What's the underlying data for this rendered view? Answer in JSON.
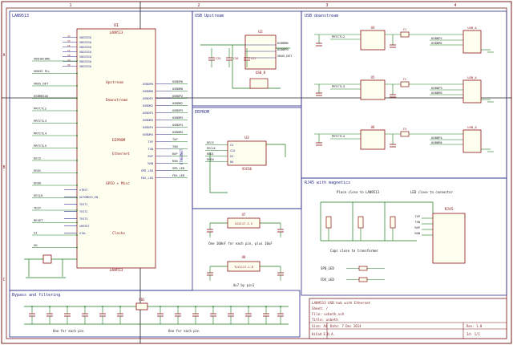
{
  "sheet": {
    "frame_color": "#7a1e1e",
    "section_color": "#2d2d8c",
    "wire_color": "#1a7a1a",
    "part_color": "#8a1010",
    "label_color": "#1a1a1a",
    "pin_color": "#2d2d8c",
    "top_ruler": [
      "1",
      "2",
      "3",
      "4"
    ],
    "side_ruler": [
      "A",
      "B",
      "C"
    ]
  },
  "sections": {
    "main": "LAN9513",
    "usb_upstream": "USB Upstream",
    "usb_downstream": "USB downstream",
    "eeprom": "EEPROM",
    "rj45": "RJ45 with magnetics",
    "bypass": "Bypass and filtering"
  },
  "main": {
    "ic_ref": "U1",
    "ic_value": "LAN9513",
    "ic_footer": "LAN9513",
    "left_pins": [
      "VDD33IO",
      "VDD33IO",
      "VDD33IO",
      "VDD33IO",
      "VDD33IO",
      "VDD33IO",
      "VDD33IO"
    ],
    "nets_left": [
      "VDD18CORE",
      "VDD33 PLL",
      "VBUS_DET",
      "USBRBIAS",
      "PRTCTL2",
      "PRTCTL3",
      "PRTCTL4",
      "PRTCTL5",
      "EECS",
      "EEDI",
      "EEDO",
      "EECLK",
      "TEST",
      "RESET",
      "XI",
      "XO"
    ],
    "right_pins": [
      "USBDP0",
      "USBDM0",
      "USBDP2",
      "USBDM2",
      "USBDP3",
      "USBDM3",
      "USBDP4",
      "USBDM4",
      "TXP",
      "TXN",
      "RXP",
      "RXN",
      "SPD_LED",
      "FDX_LED"
    ],
    "labels": {
      "upstream": "Upstream",
      "downstream": "Downstream",
      "eeprom": "EEPROM",
      "ethernet": "Ethernet",
      "gpio": "GPIO + Misc",
      "clocks": "Clocks",
      "ethernet_side": "ETHERNET",
      "leds": "LEDs"
    },
    "misc": [
      "nTRST",
      "AUTOMDIX_EN",
      "TEST1",
      "TEST2",
      "TEST3",
      "nRESET",
      "XTAL"
    ]
  },
  "usb_up": {
    "ref": "U2",
    "connector": "USB_B",
    "nets": [
      "USBDM0",
      "USBDP0",
      "VBUS_DET"
    ],
    "caps": [
      "C25",
      "C26",
      "C27"
    ]
  },
  "usb_down": {
    "blocks": [
      {
        "ic": "U4",
        "port": "USB_A",
        "enable": "PRTCTL2",
        "nets": [
          "USBDP2",
          "USBDM2"
        ],
        "fuse": "F1"
      },
      {
        "ic": "U5",
        "port": "USB_A",
        "enable": "PRTCTL3",
        "nets": [
          "USBDP3",
          "USBDM3"
        ],
        "fuse": "F2"
      },
      {
        "ic": "U6",
        "port": "USB_A",
        "enable": "PRTCTL4",
        "nets": [
          "USBDP4",
          "USBDM4"
        ],
        "fuse": "F3"
      }
    ]
  },
  "eeprom": {
    "ref": "U3",
    "value": "93C66",
    "pins": [
      "CS",
      "CLK",
      "DI",
      "DO"
    ],
    "nets": [
      "EECS",
      "EECLK",
      "EEDI",
      "EEDO"
    ]
  },
  "reg": {
    "ref1": "U7",
    "name1": "LD1117-3.3",
    "note1": "One 100nF for each pin, plus 10uF",
    "ref2": "U8",
    "name2": "TLV1117-1.8",
    "note2": "4u7 by pin1"
  },
  "rj45": {
    "note_left": "Place close to LAN9513",
    "note_right": "LED close to connector",
    "note_bottom": "Caps close to transformer",
    "connector": "RJ45",
    "nets": [
      "TXP",
      "TXN",
      "RXP",
      "RXN"
    ],
    "leds": [
      "SPD_LED",
      "FDX_LED"
    ]
  },
  "bypass": {
    "ferrite": "FB1",
    "note1": "One for each pin",
    "note2": "One for each pin"
  },
  "title_block": {
    "line1": "LAN9513 USB hub with Ethernet",
    "line2": "Sheet: /",
    "line3": "File: usbeth.sch",
    "line4": "Title: usbeth",
    "size": "Size: A4",
    "date": "Date: 7 Dec 2014",
    "rev": "Rev: 1.0",
    "kicad": "KiCad E.D.A.",
    "id": "Id: 1/1"
  }
}
